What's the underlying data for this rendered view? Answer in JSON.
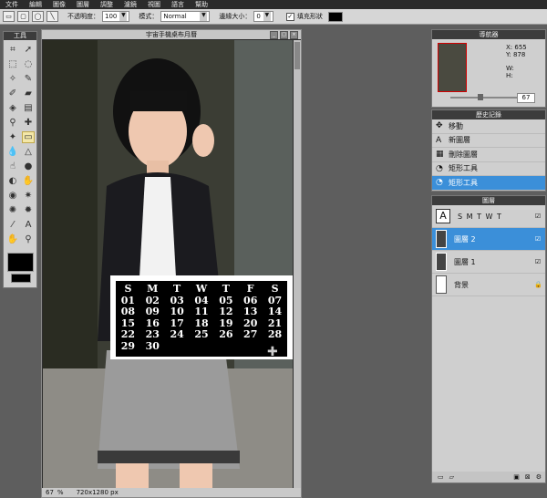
{
  "menubar": {
    "items": [
      "文件",
      "編輯",
      "圖像",
      "圖層",
      "調整",
      "濾鏡",
      "視圖",
      "語言",
      "幫助"
    ]
  },
  "optbar": {
    "opacity_label": "不透明度：",
    "opacity_value": "100",
    "mode_label": "模式：",
    "mode_value": "Normal",
    "blur_label": "邊緣大小：",
    "blur_value": "0",
    "fill_label": "填充形狀",
    "fill_color": "#000000"
  },
  "tools": {
    "title": "工具"
  },
  "document": {
    "title": "宇宙手機桌布月曆",
    "zoom": "67",
    "zoom_unit": "%",
    "size": "720x1280 px"
  },
  "calendar": {
    "headers": [
      "S",
      "M",
      "T",
      "W",
      "T",
      "F",
      "S"
    ],
    "days": [
      "01",
      "02",
      "03",
      "04",
      "05",
      "06",
      "07",
      "08",
      "09",
      "10",
      "11",
      "12",
      "13",
      "14",
      "15",
      "16",
      "17",
      "18",
      "19",
      "20",
      "21",
      "22",
      "23",
      "24",
      "25",
      "26",
      "27",
      "28",
      "29",
      "30"
    ]
  },
  "navigator": {
    "title": "導航器",
    "x_label": "X:",
    "x_value": "655",
    "y_label": "Y:",
    "y_value": "878",
    "w_label": "W:",
    "h_label": "H:",
    "zoom": "67"
  },
  "history": {
    "title": "歷史記錄",
    "items": [
      {
        "icon": "move-icon",
        "label": "移動"
      },
      {
        "icon": "text-icon",
        "label": "新圖層"
      },
      {
        "icon": "delete-icon",
        "label": "刪除圖層"
      },
      {
        "icon": "shape-icon",
        "label": "矩形工具"
      },
      {
        "icon": "shape-icon",
        "label": "矩形工具"
      }
    ]
  },
  "layers": {
    "title": "圖層",
    "text_layer_label": "S   M   T   W   T",
    "items": [
      {
        "label": "圖層 2"
      },
      {
        "label": "圖層 1"
      },
      {
        "label": "背景"
      }
    ]
  }
}
